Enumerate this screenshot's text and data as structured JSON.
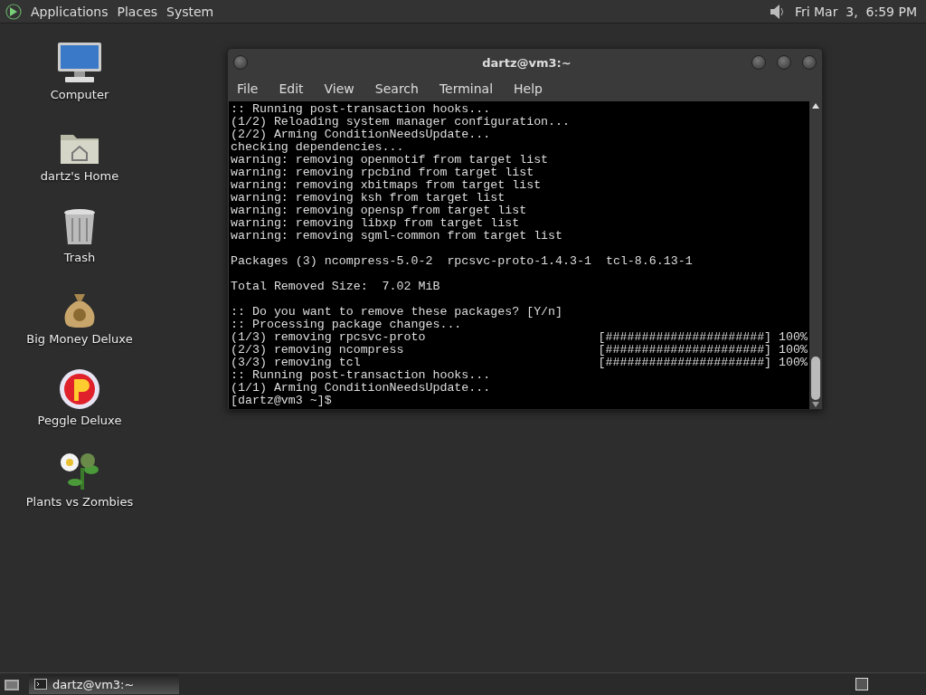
{
  "top_panel": {
    "menus": [
      "Applications",
      "Places",
      "System"
    ],
    "clock": "Fri Mar  3,  6:59 PM"
  },
  "desktop_icons": [
    {
      "kind": "computer",
      "label": "Computer"
    },
    {
      "kind": "home",
      "label": "dartz's Home"
    },
    {
      "kind": "trash",
      "label": "Trash"
    },
    {
      "kind": "moneybag",
      "label": "Big Money Deluxe"
    },
    {
      "kind": "ball",
      "label": "Peggle Deluxe"
    },
    {
      "kind": "flower",
      "label": "Plants vs Zombies"
    }
  ],
  "window": {
    "title": "dartz@vm3:~",
    "menu": [
      "File",
      "Edit",
      "View",
      "Search",
      "Terminal",
      "Help"
    ],
    "lines": [
      {
        "kind": "text",
        "text": ":: Running post-transaction hooks..."
      },
      {
        "kind": "text",
        "text": "(1/2) Reloading system manager configuration..."
      },
      {
        "kind": "text",
        "text": "(2/2) Arming ConditionNeedsUpdate..."
      },
      {
        "kind": "text",
        "text": "checking dependencies..."
      },
      {
        "kind": "text",
        "text": "warning: removing openmotif from target list"
      },
      {
        "kind": "text",
        "text": "warning: removing rpcbind from target list"
      },
      {
        "kind": "text",
        "text": "warning: removing xbitmaps from target list"
      },
      {
        "kind": "text",
        "text": "warning: removing ksh from target list"
      },
      {
        "kind": "text",
        "text": "warning: removing opensp from target list"
      },
      {
        "kind": "text",
        "text": "warning: removing libxp from target list"
      },
      {
        "kind": "text",
        "text": "warning: removing sgml-common from target list"
      },
      {
        "kind": "blank"
      },
      {
        "kind": "text",
        "text": "Packages (3) ncompress-5.0-2  rpcsvc-proto-1.4.3-1  tcl-8.6.13-1"
      },
      {
        "kind": "blank"
      },
      {
        "kind": "text",
        "text": "Total Removed Size:  7.02 MiB"
      },
      {
        "kind": "blank"
      },
      {
        "kind": "text",
        "text": ":: Do you want to remove these packages? [Y/n]"
      },
      {
        "kind": "text",
        "text": ":: Processing package changes..."
      },
      {
        "kind": "progress",
        "text": "(1/3) removing rpcsvc-proto",
        "bar": "[######################]",
        "percent": "100%"
      },
      {
        "kind": "progress",
        "text": "(2/3) removing ncompress",
        "bar": "[######################]",
        "percent": "100%"
      },
      {
        "kind": "progress",
        "text": "(3/3) removing tcl",
        "bar": "[######################]",
        "percent": "100%"
      },
      {
        "kind": "text",
        "text": ":: Running post-transaction hooks..."
      },
      {
        "kind": "text",
        "text": "(1/1) Arming ConditionNeedsUpdate..."
      },
      {
        "kind": "text",
        "text": "[dartz@vm3 ~]$"
      }
    ]
  },
  "taskbar": {
    "items": [
      {
        "label": "dartz@vm3:~",
        "selected": true
      }
    ]
  }
}
